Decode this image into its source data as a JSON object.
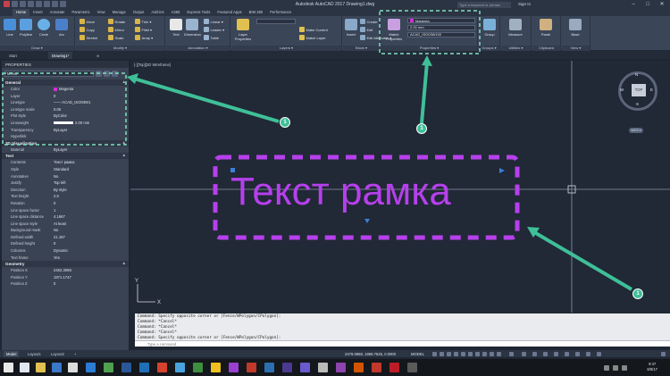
{
  "window": {
    "title": "Autodesk AutoCAD 2017   Drawing1.dwg",
    "search_placeholder": "Type a keyword or phrase",
    "sign_in": "Sign In",
    "controls": [
      "–",
      "□",
      "✕"
    ]
  },
  "ribbon_tabs": [
    "Home",
    "Insert",
    "Annotate",
    "Parametric",
    "View",
    "Manage",
    "Output",
    "Add-ins",
    "A360",
    "Express Tools",
    "Featured Apps",
    "BIM 360",
    "Performance"
  ],
  "ribbon": {
    "draw": {
      "title": "Draw ▾",
      "tools": [
        "Line",
        "Polyline",
        "Circle",
        "Arc"
      ]
    },
    "modify": {
      "title": "Modify ▾",
      "tools": [
        "Move",
        "Rotate",
        "Trim ▾",
        "Copy",
        "Mirror",
        "Fillet ▾",
        "Stretch",
        "Scale",
        "Array ▾"
      ]
    },
    "annotation": {
      "title": "Annotation ▾",
      "tools": [
        "Text",
        "Dimension",
        "Linear ▾",
        "Leader ▾",
        "Table"
      ]
    },
    "layers": {
      "title": "Layers ▾",
      "tools": [
        "Layer Properties",
        "Make Current",
        "Match Layer"
      ]
    },
    "block": {
      "title": "Block ▾",
      "tools": [
        "Insert",
        "Create",
        "Edit",
        "Edit Attributes ▾"
      ]
    },
    "properties": {
      "title": "Properties ▾",
      "match": "Match Properties",
      "color": "Magenta",
      "lineweight": "2.00 mm",
      "linetype": "ACAD_ISO03W100"
    },
    "groups": {
      "title": "Groups ▾",
      "tool": "Group"
    },
    "utilities": {
      "title": "Utilities ▾",
      "tool": "Measure"
    },
    "clipboard": {
      "title": "Clipboard",
      "tool": "Paste"
    },
    "view": {
      "title": "View ▾",
      "tool": "Base"
    }
  },
  "doc_tabs": [
    "Start",
    "Drawing1*"
  ],
  "properties_palette": {
    "header": "PROPERTIES",
    "selection": "MText",
    "sections": {
      "general": {
        "title": "General",
        "rows": [
          {
            "name": "Color",
            "value": "Magenta"
          },
          {
            "name": "Layer",
            "value": "0"
          },
          {
            "name": "Linetype",
            "value": "—— ACAD_ISO03W1"
          },
          {
            "name": "Linetype scale",
            "value": "0.05"
          },
          {
            "name": "Plot style",
            "value": "ByColor"
          },
          {
            "name": "Lineweight",
            "value": "2.00 mm"
          },
          {
            "name": "Transparency",
            "value": "ByLayer"
          },
          {
            "name": "Hyperlink",
            "value": ""
          }
        ]
      },
      "visualization": {
        "title": "3D Visualization",
        "rows": [
          {
            "name": "Material",
            "value": "ByLayer"
          }
        ]
      },
      "text": {
        "title": "Text",
        "rows": [
          {
            "name": "Contents",
            "value": "Текст рамка"
          },
          {
            "name": "Style",
            "value": "Standard"
          },
          {
            "name": "Annotative",
            "value": "No"
          },
          {
            "name": "Justify",
            "value": "Top left"
          },
          {
            "name": "Direction",
            "value": "By style"
          },
          {
            "name": "Text height",
            "value": "2.5"
          },
          {
            "name": "Rotation",
            "value": "0"
          },
          {
            "name": "Line space factor",
            "value": "1"
          },
          {
            "name": "Line space distance",
            "value": "4.1667"
          },
          {
            "name": "Line space style",
            "value": "At least"
          },
          {
            "name": "Background mask",
            "value": "No"
          },
          {
            "name": "Defined width",
            "value": "21.187"
          },
          {
            "name": "Defined height",
            "value": "0"
          },
          {
            "name": "Columns",
            "value": "Dynamic"
          },
          {
            "name": "Text frame",
            "value": "Yes"
          }
        ]
      },
      "geometry": {
        "title": "Geometry",
        "rows": [
          {
            "name": "Position X",
            "value": "2452.3068"
          },
          {
            "name": "Position Y",
            "value": "1871.1747"
          },
          {
            "name": "Position Z",
            "value": "0"
          }
        ]
      }
    }
  },
  "canvas": {
    "viewport_label": "[-][Top][2D Wireframe]",
    "mtext": "Текст рамка",
    "viewcube": {
      "face": "TOP",
      "n": "N",
      "s": "S",
      "e": "E",
      "w": "W",
      "wcs": "WCS ▾"
    },
    "ucs": {
      "x": "X",
      "y": "Y"
    }
  },
  "command_window": {
    "history": [
      "Command: Specify opposite corner or [Fence/WPolygon/CPolygon]:",
      "Command: *Cancel*",
      "Command: *Cancel*",
      "Command: *Cancel*",
      "Command: Specify opposite corner or [Fence/WPolygon/CPolygon]:"
    ],
    "placeholder": "Type a command"
  },
  "status_bar": {
    "layout_tabs": [
      "Model",
      "Layout1",
      "Layout2",
      "+"
    ],
    "coords": "2479.0668, 1869.7525, 0.0000",
    "mode": "MODEL"
  },
  "taskbar": {
    "time": "9:47",
    "date": "8/8/17"
  },
  "callouts": [
    "1",
    "1",
    "1"
  ],
  "colors": {
    "accent_magenta": "#b640ec",
    "callout_green": "#3fbf98",
    "highlight_dash": "#7fe0c0"
  }
}
